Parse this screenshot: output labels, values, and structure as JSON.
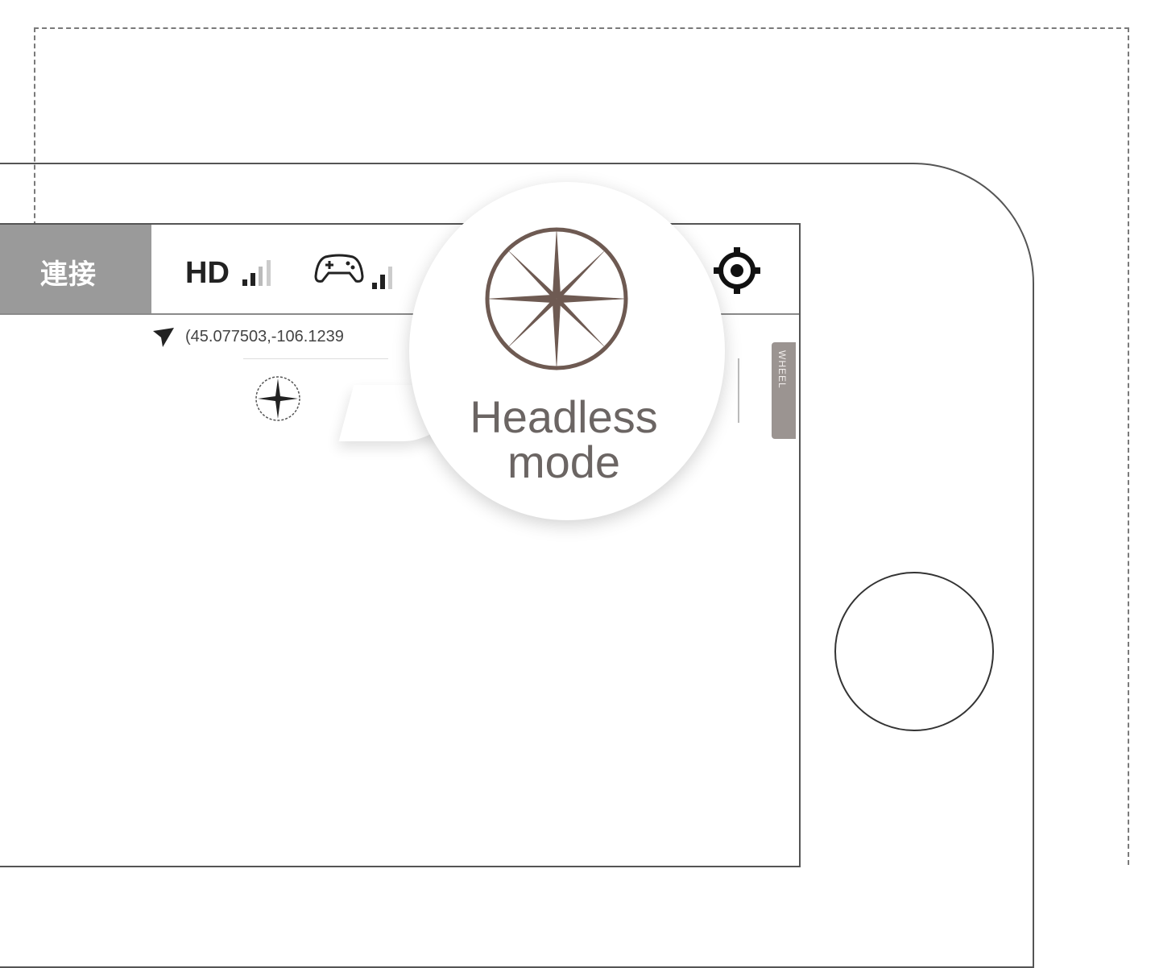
{
  "status_bar": {
    "connect_label": "連接",
    "video_label": "HD",
    "coordinates": "(45.077503,-106.1239"
  },
  "side_tab": {
    "label": "WHEEL"
  },
  "bubble": {
    "line1": "Headless",
    "line2": "mode"
  },
  "icons": {
    "video_signal": "signal-bars-icon",
    "controller": "gamepad-icon",
    "settings": "gear-icon",
    "location": "navigation-arrow-icon",
    "headless": "compass-rose-icon"
  },
  "colors": {
    "connect_bg": "#9a9a9a",
    "compass": "#6e5a52",
    "side_tab": "#9b9491"
  }
}
